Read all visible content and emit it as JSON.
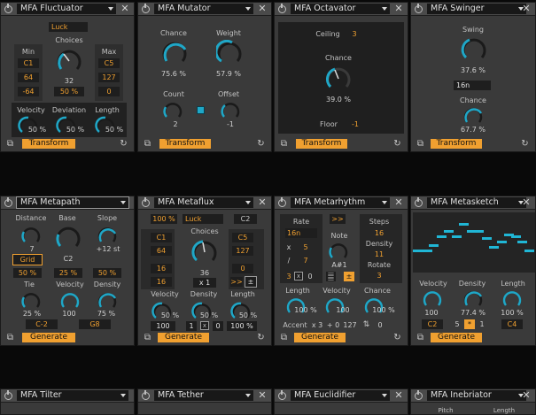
{
  "devices": {
    "fluctuator": {
      "name": "MFA Fluctuator",
      "dropdown": "Luck",
      "choices": "Choices",
      "min": "Min",
      "max": "Max",
      "min_note": "C1",
      "max_note": "C5",
      "min_vel": "64",
      "max_vel": "127",
      "min_val": "-64",
      "max_val": "0",
      "choice_val": "32",
      "pct": "50 %",
      "velocity": "Velocity",
      "deviation": "Deviation",
      "length": "Length",
      "v1": "50 %",
      "v2": "50 %",
      "v3": "50 %",
      "button": "Transform"
    },
    "mutator": {
      "name": "MFA Mutator",
      "chance": "Chance",
      "weight": "Weight",
      "chance_val": "75.6 %",
      "weight_val": "57.9 %",
      "count": "Count",
      "offset": "Offset",
      "count_val": "2",
      "offset_val": "-1",
      "button": "Transform"
    },
    "octavator": {
      "name": "MFA Octavator",
      "ceiling": "Ceiling",
      "ceiling_val": "3",
      "chance": "Chance",
      "chance_val": "39.0 %",
      "floor": "Floor",
      "floor_val": "-1",
      "button": "Transform"
    },
    "swinger": {
      "name": "MFA Swinger",
      "swing": "Swing",
      "swing_val": "37.6 %",
      "rate": "16n",
      "chance": "Chance",
      "chance_val": "67.7 %",
      "button": "Transform"
    },
    "metapath": {
      "name": "MFA Metapath",
      "distance": "Distance",
      "base": "Base",
      "slope": "Slope",
      "distance_val": "7",
      "base_val": "C2",
      "slope_val": "+12 st",
      "grid": "Grid",
      "p1": "50 %",
      "p2": "25 %",
      "p3": "50 %",
      "tie": "Tie",
      "velocity": "Velocity",
      "density": "Density",
      "tie_val": "25 %",
      "vel_val": "100",
      "den_val": "75 %",
      "low": "C-2",
      "high": "G8",
      "button": "Generate"
    },
    "metaflux": {
      "name": "MFA Metaflux",
      "pct": "100 %",
      "dropdown": "Luck",
      "note": "C2",
      "choices": "Choices",
      "n1": "C1",
      "n2": "C5",
      "v1": "64",
      "v2": "127",
      "b1": "16",
      "b2": "16",
      "b3": "0",
      "choice_val": "36",
      "mult": "x 1",
      "arrows": ">>",
      "pm": "±",
      "velocity": "Velocity",
      "density": "Density",
      "length": "Length",
      "vel_val": "50 %",
      "den_val": "50 %",
      "len_val": "50 %",
      "f1": "100",
      "f2": "1",
      "f3": "x",
      "f4": "0",
      "f5": "100 %",
      "button": "Generate"
    },
    "metarhythm": {
      "name": "MFA Metarhythm",
      "rate": "Rate",
      "rate_val": "16n",
      "x_lbl": "x",
      "x_val": "5",
      "div_lbl": "/",
      "div_val": "7",
      "n3": "3",
      "xb": "x",
      "n0": "0",
      "arrows": ">>",
      "note": "Note",
      "note_val": "A#1",
      "steps": "Steps",
      "steps_val": "16",
      "density": "Density",
      "density_val": "11",
      "rotate": "Rotate",
      "rotate_val": "3",
      "pm": "±",
      "length": "Length",
      "velocity": "Velocity",
      "chance": "Chance",
      "len_val": "100 %",
      "vel_val": "100",
      "ch_val": "100 %",
      "accent": "Accent",
      "acc_x": "x 3",
      "acc_plus": "+ 0",
      "acc_127": "127",
      "acc_0": "0",
      "button": "Generate"
    },
    "metasketch": {
      "name": "MFA Metasketch",
      "velocity": "Velocity",
      "density": "Density",
      "length": "Length",
      "vel_val": "100",
      "den_val": "77.4 %",
      "len_val": "100 %",
      "low": "C2",
      "mid": "5",
      "one": "1",
      "high": "C4",
      "button": "Generate"
    },
    "tilter": {
      "name": "MFA Tilter"
    },
    "tether": {
      "name": "MFA Tether"
    },
    "euclidifier": {
      "name": "MFA Euclidifier"
    },
    "inebriator": {
      "name": "MFA Inebriator",
      "pitch": "Pitch",
      "length": "Length"
    }
  }
}
